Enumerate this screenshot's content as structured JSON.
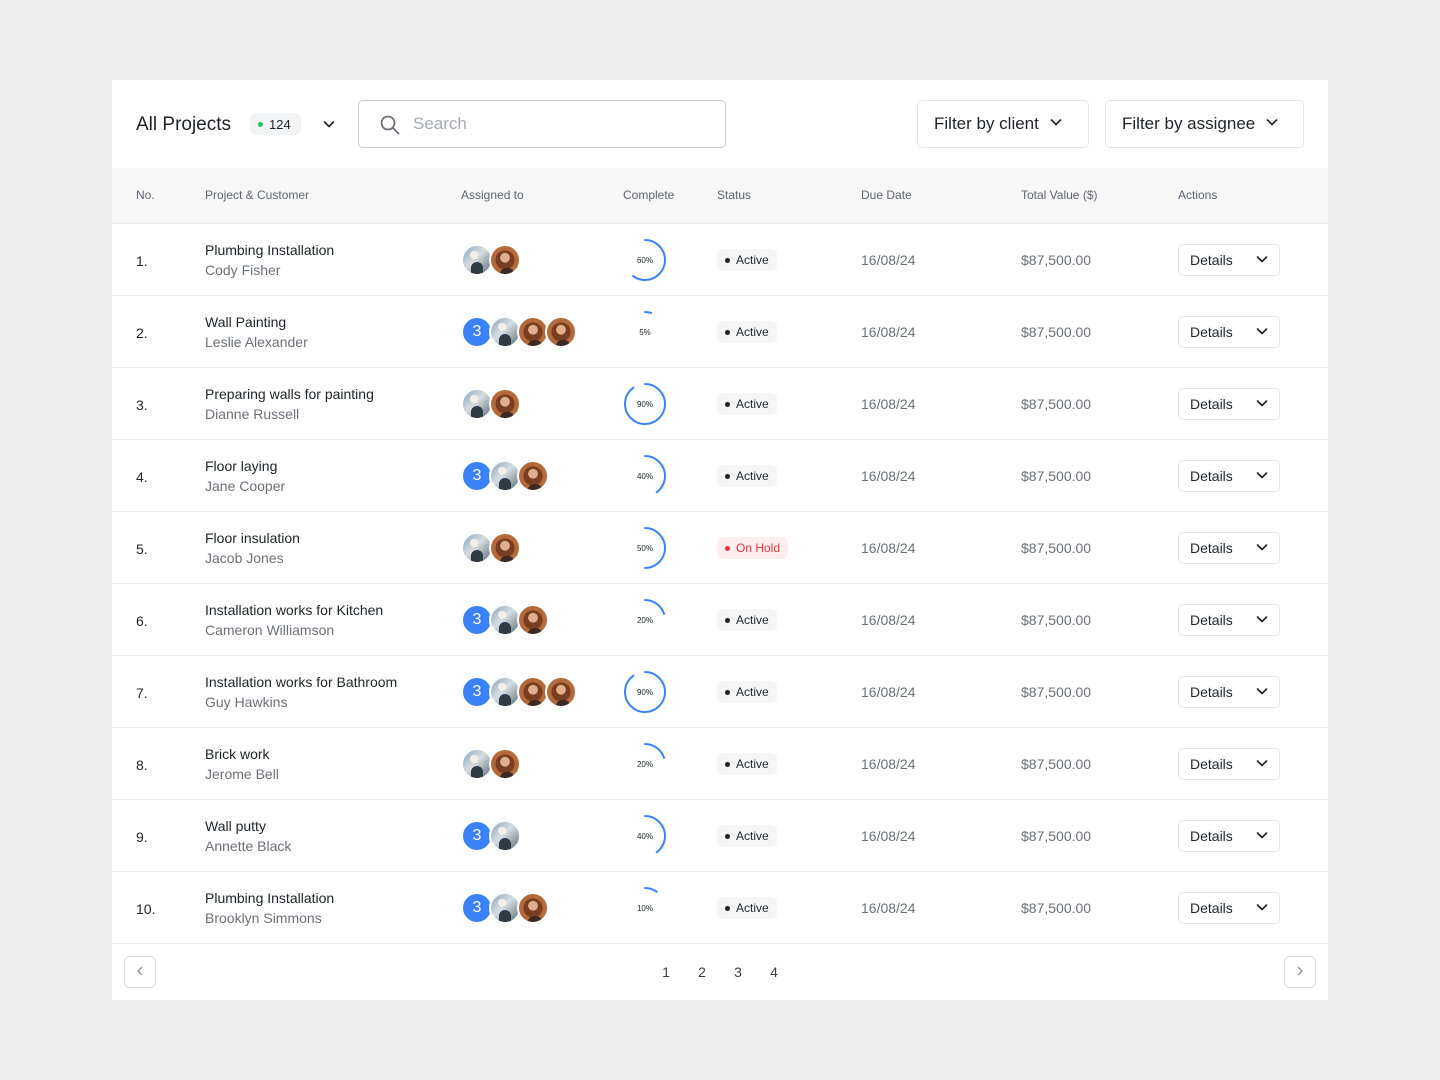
{
  "header": {
    "title": "All Projects",
    "count": "124",
    "count_dot_color": "#22c55e",
    "search": {
      "placeholder": "Search",
      "value": ""
    },
    "filter_client_label": "Filter by client",
    "filter_assignee_label": "Filter by assignee"
  },
  "table": {
    "columns": [
      "No.",
      "Project & Customer",
      "Assigned to",
      "Complete",
      "Status",
      "Due Date",
      "Total Value ($)",
      "Actions"
    ],
    "rows": [
      {
        "no": "1.",
        "project": "Plumbing Installation",
        "customer": "Cody Fisher",
        "extra_count": "",
        "avatars": [
          "photo-a",
          "photo-b"
        ],
        "complete": 60,
        "complete_label": "60%",
        "status": "Active",
        "due": "16/08/24",
        "value": "$87,500.00",
        "action": "Details"
      },
      {
        "no": "2.",
        "project": "Wall Painting",
        "customer": "Leslie Alexander",
        "extra_count": "3",
        "avatars": [
          "photo-a",
          "photo-b",
          "photo-b"
        ],
        "complete": 5,
        "complete_label": "5%",
        "status": "Active",
        "due": "16/08/24",
        "value": "$87,500.00",
        "action": "Details"
      },
      {
        "no": "3.",
        "project": "Preparing walls for painting",
        "customer": "Dianne Russell",
        "extra_count": "",
        "avatars": [
          "photo-a",
          "photo-b"
        ],
        "complete": 90,
        "complete_label": "90%",
        "status": "Active",
        "due": "16/08/24",
        "value": "$87,500.00",
        "action": "Details"
      },
      {
        "no": "4.",
        "project": "Floor laying",
        "customer": "Jane Cooper",
        "extra_count": "3",
        "avatars": [
          "photo-a",
          "photo-b"
        ],
        "complete": 40,
        "complete_label": "40%",
        "status": "Active",
        "due": "16/08/24",
        "value": "$87,500.00",
        "action": "Details"
      },
      {
        "no": "5.",
        "project": "Floor insulation",
        "customer": "Jacob Jones",
        "extra_count": "",
        "avatars": [
          "photo-a",
          "photo-b"
        ],
        "complete": 50,
        "complete_label": "50%",
        "status": "On Hold",
        "due": "16/08/24",
        "value": "$87,500.00",
        "action": "Details"
      },
      {
        "no": "6.",
        "project": "Installation works for Kitchen",
        "customer": "Cameron Williamson",
        "extra_count": "3",
        "avatars": [
          "photo-a",
          "photo-b"
        ],
        "complete": 20,
        "complete_label": "20%",
        "status": "Active",
        "due": "16/08/24",
        "value": "$87,500.00",
        "action": "Details"
      },
      {
        "no": "7.",
        "project": "Installation works for Bathroom",
        "customer": "Guy Hawkins",
        "extra_count": "3",
        "avatars": [
          "photo-a",
          "photo-b",
          "photo-b"
        ],
        "complete": 90,
        "complete_label": "90%",
        "status": "Active",
        "due": "16/08/24",
        "value": "$87,500.00",
        "action": "Details"
      },
      {
        "no": "8.",
        "project": "Brick work",
        "customer": "Jerome Bell",
        "extra_count": "",
        "avatars": [
          "photo-a",
          "photo-b"
        ],
        "complete": 20,
        "complete_label": "20%",
        "status": "Active",
        "due": "16/08/24",
        "value": "$87,500.00",
        "action": "Details"
      },
      {
        "no": "9.",
        "project": "Wall putty",
        "customer": "Annette Black",
        "extra_count": "3",
        "avatars": [
          "photo-a"
        ],
        "complete": 40,
        "complete_label": "40%",
        "status": "Active",
        "due": "16/08/24",
        "value": "$87,500.00",
        "action": "Details"
      },
      {
        "no": "10.",
        "project": "Plumbing Installation",
        "customer": "Brooklyn Simmons",
        "extra_count": "3",
        "avatars": [
          "photo-a",
          "photo-b"
        ],
        "complete": 10,
        "complete_label": "10%",
        "status": "Active",
        "due": "16/08/24",
        "value": "$87,500.00",
        "action": "Details"
      }
    ]
  },
  "pagination": {
    "pages": [
      "1",
      "2",
      "3",
      "4"
    ]
  },
  "colors": {
    "progress_arc": "#3b82f6",
    "avatar_count_bg": "#3b82f6",
    "status_hold_text": "#e0383e",
    "status_hold_bg": "#fdecec"
  },
  "icons": {
    "title_dropdown": "chevron-down-icon",
    "search": "search-icon",
    "filter": "chevron-down-icon",
    "details": "chevron-down-icon",
    "prev": "chevron-left-icon",
    "next": "chevron-right-icon"
  }
}
